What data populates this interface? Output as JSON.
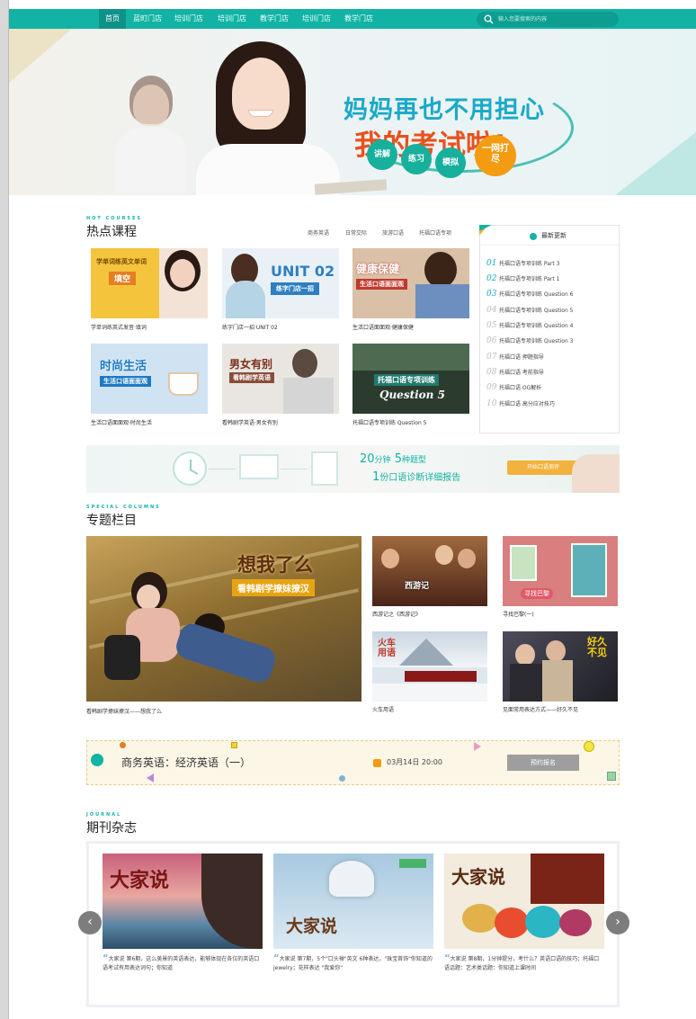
{
  "nav": {
    "items": [
      "首页",
      "蓝町门店",
      "培训门店",
      "培训门店",
      "教学门店",
      "培训门店",
      "教学门店"
    ],
    "search_placeholder": "输入您要搜索的内容"
  },
  "banner": {
    "headline_1": "妈妈再也不用担心",
    "headline_2": "我的考试啦!",
    "bubbles": [
      "讲解",
      "练习",
      "模拟",
      "一网打尽"
    ]
  },
  "hot": {
    "en": "HOT COURSES",
    "title": "热点课程",
    "filters": [
      "商务英语",
      "日常交际",
      "旅游口语",
      "托福口语专项"
    ],
    "cards": [
      {
        "thumb_title": "学单词练英文单词",
        "thumb_sub": "填空",
        "caption": "学单词练英式发音·填词"
      },
      {
        "thumb_title": "UNIT 02",
        "thumb_sub": "练字门店一招",
        "caption": "练字门店一招·UNIT 02"
      },
      {
        "thumb_title": "健康保健",
        "thumb_sub": "生活口语面面观",
        "caption": "生活口语面面观·健康保健"
      },
      {
        "thumb_title": "时尚生活",
        "thumb_sub": "生活口语面面观",
        "caption": "生活口语面面观·时尚生活"
      },
      {
        "thumb_title": "男女有别",
        "thumb_sub": "看韩剧学英语",
        "caption": "看韩剧学英语·男女有别"
      },
      {
        "thumb_title": "托福口语专项训练",
        "thumb_sub": "Question 5",
        "caption": "托福口语专项训练 Question 5"
      }
    ]
  },
  "side": {
    "title": "最新更新",
    "items": [
      {
        "n": "01",
        "t": "托福口语专项训练 Part 3"
      },
      {
        "n": "02",
        "t": "托福口语专项训练 Part 1"
      },
      {
        "n": "03",
        "t": "托福口语专项训练 Question 6"
      },
      {
        "n": "04",
        "t": "托福口语专项训练 Question 5"
      },
      {
        "n": "05",
        "t": "托福口语专项训练 Question 4"
      },
      {
        "n": "06",
        "t": "托福口语专项训练 Question 3"
      },
      {
        "n": "07",
        "t": "托福口语 押题指导"
      },
      {
        "n": "08",
        "t": "托福口语 考前指导"
      },
      {
        "n": "09",
        "t": "托福口语 OG解析"
      },
      {
        "n": "10",
        "t": "托福口语 高分应对技巧"
      }
    ]
  },
  "promo": {
    "line1_num1": "20",
    "line1_unit1": "分钟",
    "line1_num2": "5",
    "line1_unit2": "种题型",
    "line2_num": "1",
    "line2_text": "份口语诊断详细报告",
    "button": "开始口语测评"
  },
  "topics": {
    "en": "SPECIAL COLUMNS",
    "title": "专题栏目",
    "big_overlay_1": "想我了么",
    "big_overlay_2": "看韩剧学撩妹撩汉",
    "big_caption": "看韩剧学撩妹撩汉——想我了么",
    "cards": [
      {
        "overlay": "西游记",
        "caption": "西游记之《西游记》"
      },
      {
        "overlay": "寻找巴黎",
        "caption": "寻找巴黎(一)"
      },
      {
        "overlay": "火车用语",
        "caption": "火车用语"
      },
      {
        "overlay": "好久不见",
        "caption": "见面常用表达方式——好久不见"
      }
    ]
  },
  "live": {
    "title": "商务英语：经济英语（一）",
    "time": "03月14日 20:00",
    "button": "预约报名"
  },
  "mags": {
    "en": "JOURNAL",
    "title": "期刊杂志",
    "items": [
      {
        "cover": "大家说",
        "desc": "大家说 第6期，这么美景的英语表达，能够体现在各位的英语口语考试有用表达词句；你知道"
      },
      {
        "cover": "大家说",
        "desc": "大家说 第7期，5个\"口头禅\"英文 6种表达，\"珠宝首饰\"你知道的 jewelry；花样表达 \"我爱你\""
      },
      {
        "cover": "大家说",
        "desc": "大家说 第8期，1分钟提分，考什么？英语口语的技巧；托福口语话题：艺术类话题：你知道上课时间"
      }
    ],
    "prev": "‹",
    "next": "›"
  },
  "colors": {
    "brand": "#12b3a4",
    "accent": "#f39c12",
    "headline_blue": "#1aa9c8",
    "headline_red": "#e8511e"
  }
}
